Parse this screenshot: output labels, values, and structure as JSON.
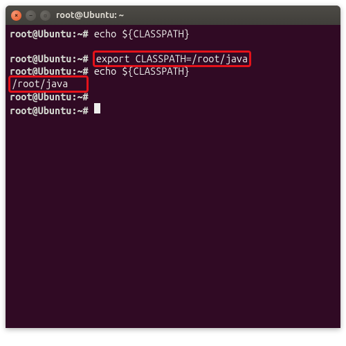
{
  "window": {
    "title": "root@Ubuntu: ~"
  },
  "controls": {
    "close_glyph": "×",
    "min_glyph": "−",
    "max_glyph": "▫"
  },
  "lines": {
    "l1_prompt": "root@Ubuntu:~#",
    "l1_cmd": "echo ${CLASSPATH}",
    "l2_blank": "",
    "l3_prompt": "root@Ubuntu:~#",
    "l3_cmd": "export CLASSPATH=/root/java",
    "l4_prompt": "root@Ubuntu:~#",
    "l4_cmd": "echo ${CLASSPATH}",
    "l5_output": "/root/java",
    "l6_prompt": "root@Ubuntu:~#",
    "l7_prompt": "root@Ubuntu:~#"
  },
  "highlights": {
    "color": "#e4121a"
  }
}
